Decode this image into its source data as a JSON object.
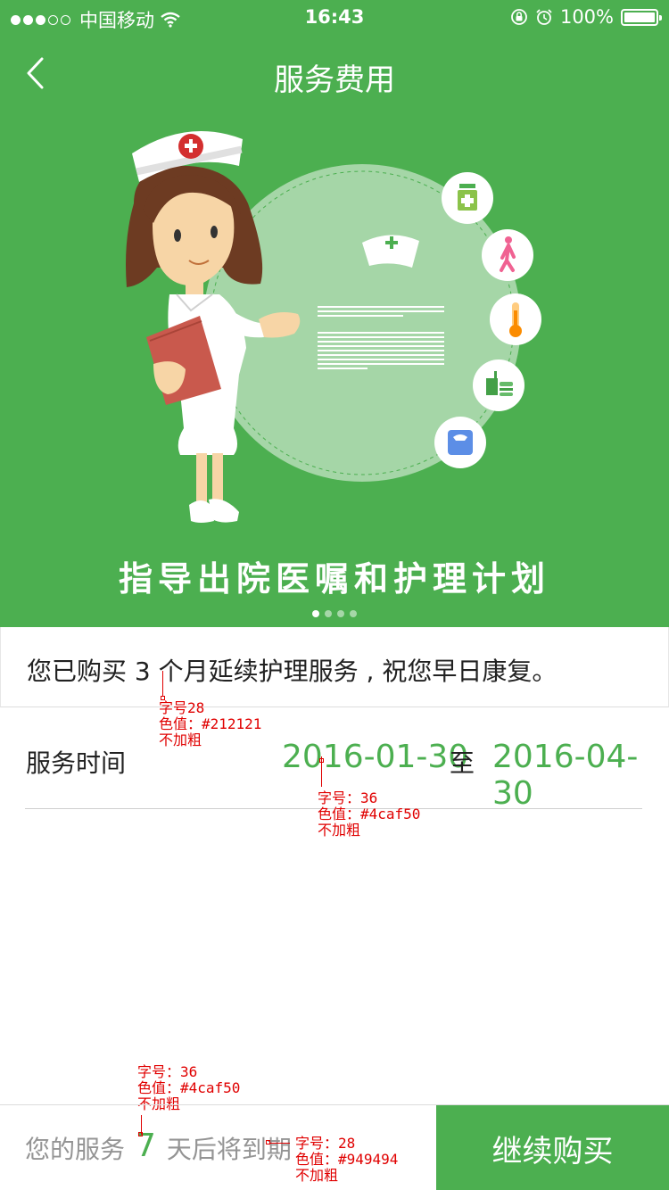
{
  "status_bar": {
    "carrier": "中国移动",
    "time": "16:43",
    "battery": "100%"
  },
  "nav": {
    "title": "服务费用"
  },
  "banner": {
    "caption": "指导出院医嘱和护理计划",
    "page_count": 4,
    "active_page": 1
  },
  "purchase": {
    "message": "您已购买 3 个月延续护理服务 , 祝您早日康复。"
  },
  "service_time": {
    "label": "服务时间",
    "start_date": "2016-01-30",
    "separator": "至",
    "end_date": "2016-04-30"
  },
  "annotations": {
    "purchase_spec": [
      "字号28",
      "色值：#212121",
      "不加粗"
    ],
    "date_spec": [
      "字号：36",
      "色值：#4caf50",
      "不加粗"
    ],
    "days_spec": [
      "字号：36",
      "色值：#4caf50",
      "不加粗"
    ],
    "expire_spec": [
      "字号：28",
      "色值：#949494",
      "不加粗"
    ]
  },
  "bottom": {
    "expire_prefix": "您的服务",
    "days_left": "7",
    "expire_suffix": "天后将到期",
    "renew_label": "继续购买"
  },
  "colors": {
    "accent": "#4caf50",
    "text_primary": "#212121",
    "text_secondary": "#949494",
    "annotation": "#e00000"
  },
  "icons": [
    "back-arrow-icon",
    "wifi-icon",
    "orientation-lock-icon",
    "alarm-icon",
    "battery-icon",
    "medicine-bottle-icon",
    "walking-person-icon",
    "thermometer-icon",
    "meal-icon",
    "weighing-scale-icon",
    "nurse-cap-icon"
  ]
}
